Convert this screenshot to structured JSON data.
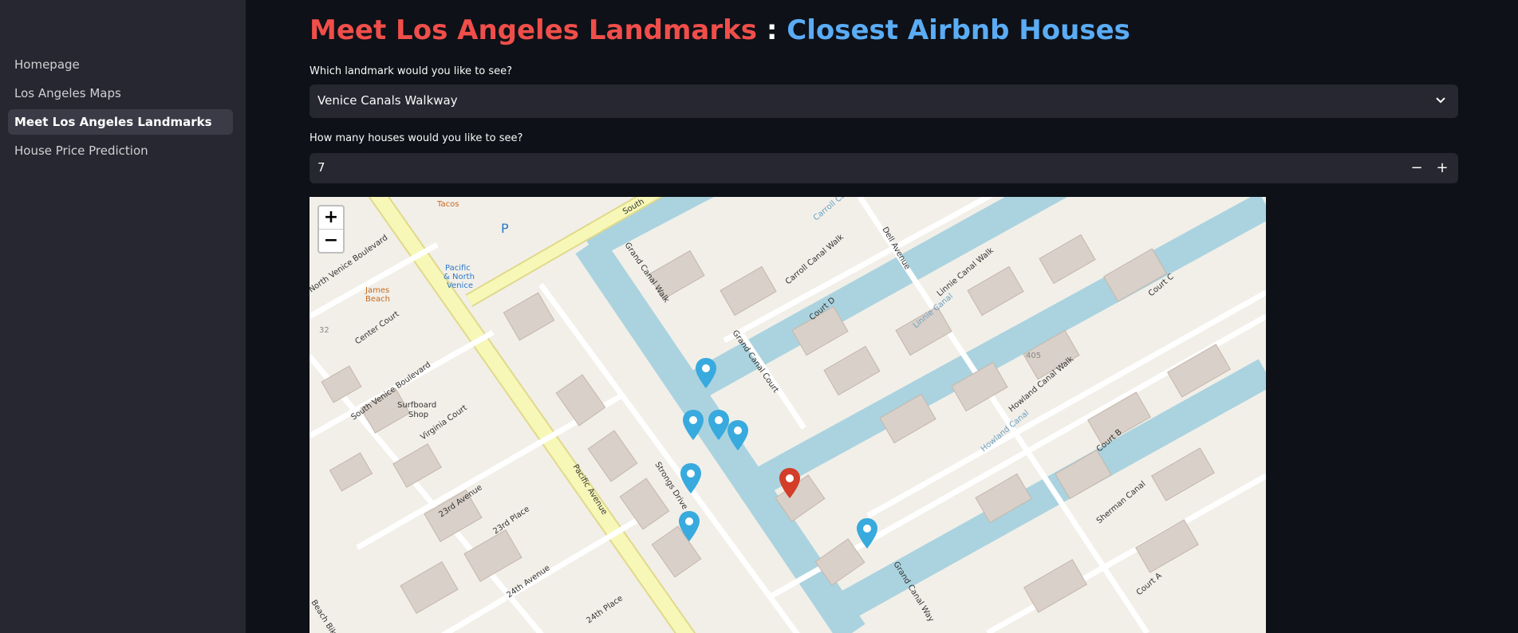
{
  "sidebar": {
    "items": [
      {
        "label": "Homepage",
        "active": false
      },
      {
        "label": "Los Angeles Maps",
        "active": false
      },
      {
        "label": "Meet Los Angeles Landmarks",
        "active": true
      },
      {
        "label": "House Price Prediction",
        "active": false
      }
    ]
  },
  "header": {
    "title_part1": "Meet Los Angeles Landmarks",
    "separator": " : ",
    "title_part2": "Closest Airbnb Houses"
  },
  "landmark_select": {
    "label": "Which landmark would you like to see?",
    "value": "Venice Canals Walkway",
    "icon": "chevron-down-icon"
  },
  "houses_input": {
    "label": "How many houses would you like to see?",
    "value": "7",
    "decrement": "−",
    "increment": "+"
  },
  "map": {
    "zoom_in": "+",
    "zoom_out": "−",
    "landmark_marker_color": "#d33d29",
    "house_marker_color": "#38aadd",
    "house_marker_count": 7,
    "street_labels": [
      "Tacos",
      "South",
      "Grand Canal Walk",
      "Carroll Canal Walk",
      "Dell Avenue",
      "Linnie Canal Walk",
      "Court C",
      "Court D",
      "P",
      "Pacific",
      "& North",
      "Venice",
      "North Venice Boulevard",
      "James",
      "Beach",
      "Center Court",
      "32",
      "South Venice Boulevard",
      "Surfboard",
      "Shop",
      "Virginia Court",
      "Grand Canal Court",
      "Linnie Canal",
      "405",
      "Howland Canal Walk",
      "Howland Canal",
      "Court B",
      "Pacific Avenue",
      "Strongs Drive",
      "Grand Canal Way",
      "Sherman Canal",
      "23rd Avenue",
      "23rd Place",
      "24th Avenue",
      "24th Place",
      "Court A",
      "Beach Bike",
      "Carroll Canal"
    ]
  }
}
